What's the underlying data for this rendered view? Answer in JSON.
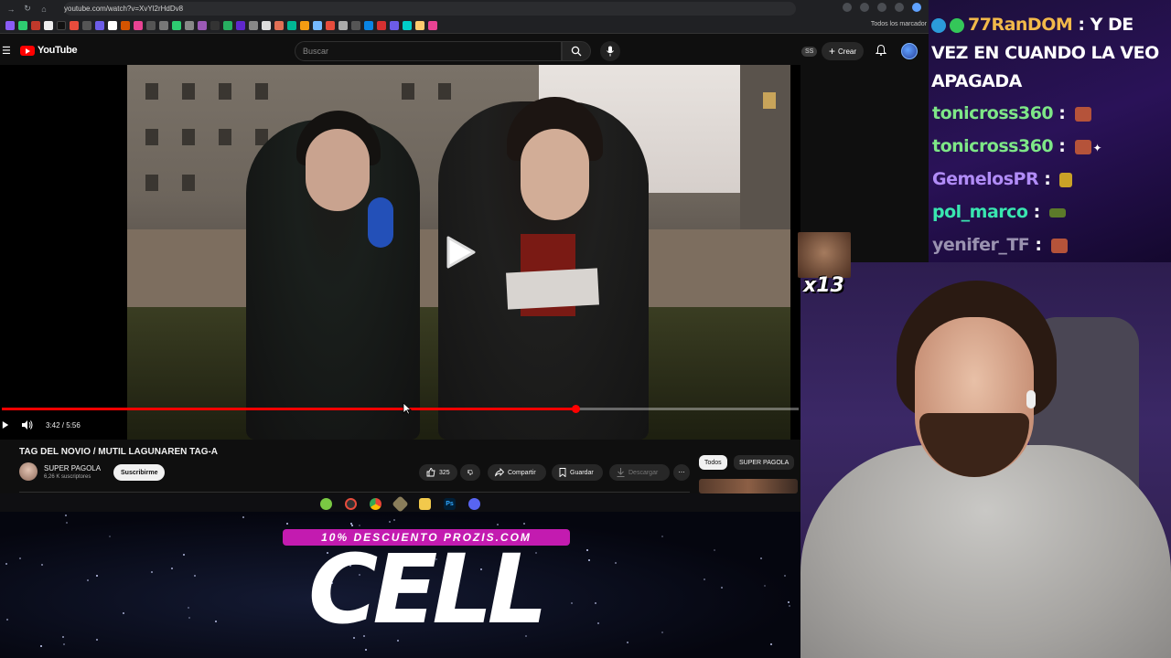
{
  "browser": {
    "url": "youtube.com/watch?v=XvYl2rHdDv8",
    "bookmarks_all_label": "Todos los marcador"
  },
  "youtube": {
    "logo_text": "YouTube",
    "search_placeholder": "Buscar",
    "ss_badge": "SS",
    "create_label": "Crear"
  },
  "player": {
    "time_display": "3:42 / 5:56",
    "progress_fraction": 0.72
  },
  "video": {
    "title": "TAG DEL NOVIO / MUTIL LAGUNAREN TAG-A",
    "channel_name": "SUPER PAGOLA",
    "subscribers": "6,26 K suscriptores",
    "subscribe_label": "Suscribirme",
    "like_count": "325",
    "share_label": "Compartir",
    "save_label": "Guardar",
    "download_label": "Descargar"
  },
  "sidebar_chips": {
    "all": "Todos",
    "channel": "SUPER PAGOLA"
  },
  "promo": {
    "banner": "10% DESCUENTO PROZIS.COM",
    "big_text": "CELL"
  },
  "chat": {
    "first_user": "77RanDOM",
    "first_message": "Y DE VEZ EN CUANDO LA VEO APAGADA",
    "messages": [
      {
        "user": "tonicross360",
        "color": "#7ee787"
      },
      {
        "user": "tonicross360",
        "color": "#7ee787"
      },
      {
        "user": "GemelosPR",
        "color": "#b18cf7"
      },
      {
        "user": "pol_marco",
        "color": "#39e6b0"
      },
      {
        "user": "yenifer_TF",
        "color": "#9a92b0"
      }
    ],
    "colon": ":"
  },
  "overlay": {
    "emote_count": "x13"
  }
}
